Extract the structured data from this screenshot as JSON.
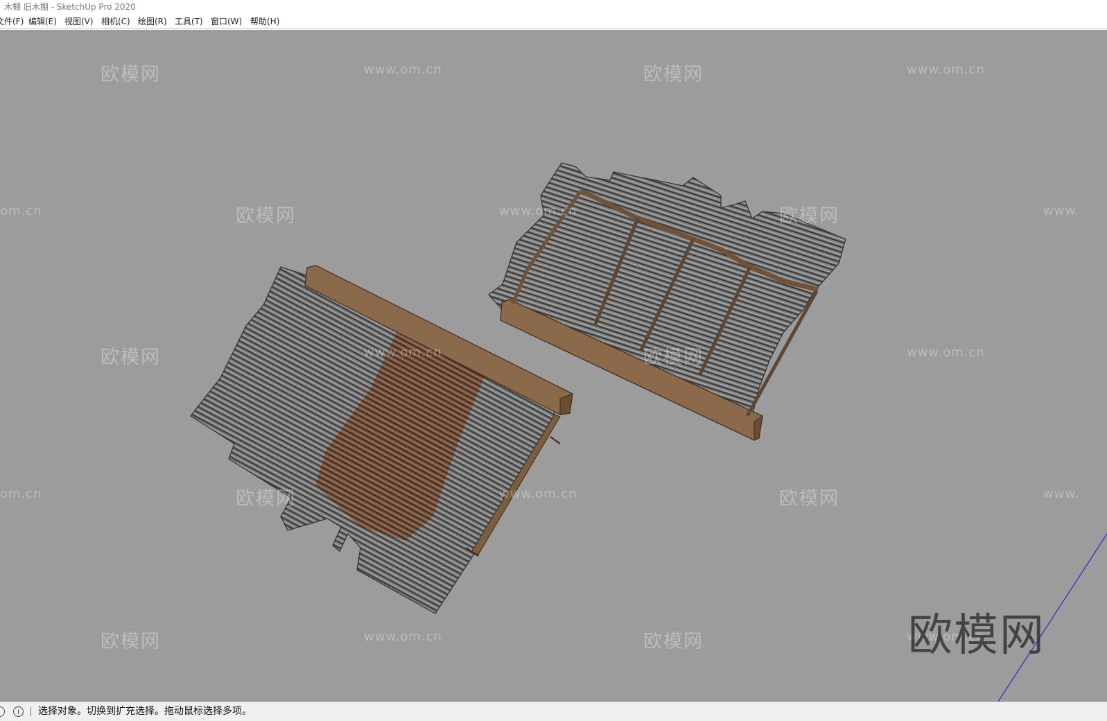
{
  "window": {
    "title": "木棚 旧木棚 - SketchUp Pro 2020"
  },
  "menu": [
    {
      "label": "文件(F)"
    },
    {
      "label": "编辑(E)"
    },
    {
      "label": "视图(V)"
    },
    {
      "label": "相机(C)"
    },
    {
      "label": "绘图(R)"
    },
    {
      "label": "工具(T)"
    },
    {
      "label": "窗口(W)"
    },
    {
      "label": "帮助(H)"
    }
  ],
  "watermark": {
    "brand": "欧模网",
    "url": "www.om.cn",
    "url_partial_left": "om.cn",
    "url_partial_right": "www."
  },
  "statusbar": {
    "info_icon": "info-icon",
    "geo_icon": "geolocation-icon",
    "message": "选择对象。切换到扩充选择。拖动鼠标选择多项。"
  },
  "colors": {
    "viewport_bg": "#9c9c9c",
    "wood": "#8a6a4a",
    "metal": "#6e6e6e",
    "rust": "#8b4a2a",
    "axis_blue": "#2a2acc"
  }
}
